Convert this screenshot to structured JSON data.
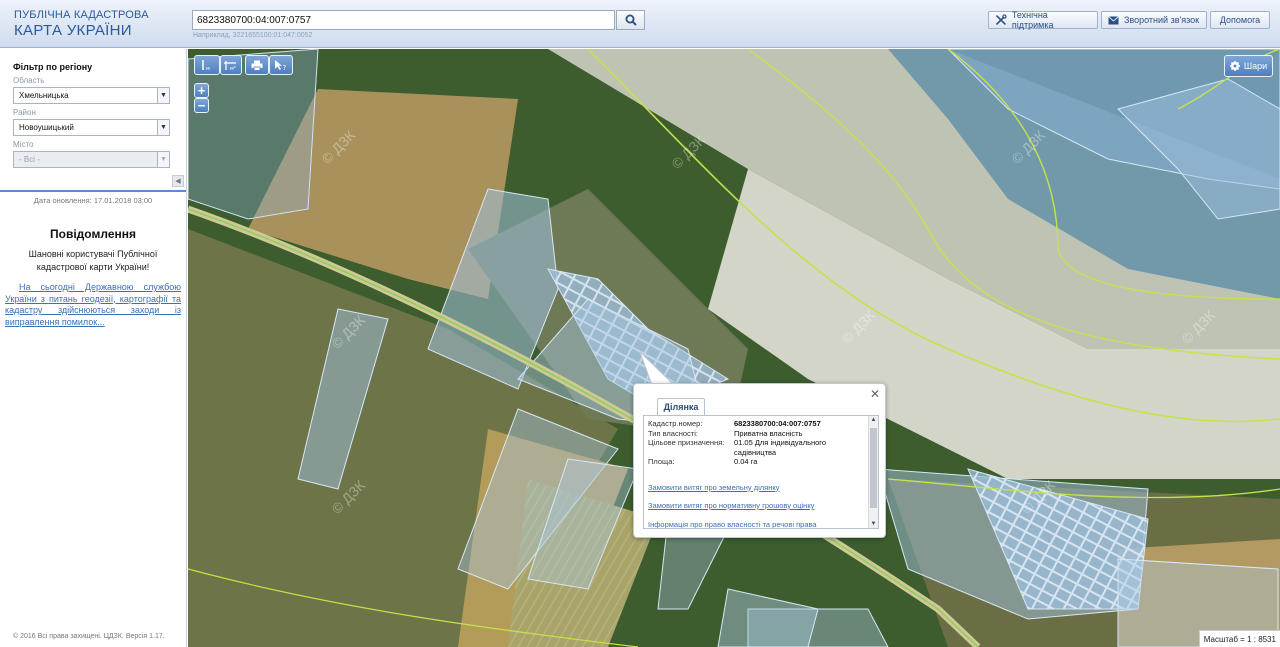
{
  "header": {
    "logo_line1": "ПУБЛІЧНА КАДАСТРОВА",
    "logo_line2": "КАРТА УКРАЇНИ",
    "search_value": "6823380700:04:007:0757",
    "search_hint": "Наприклад, 3221655100:01:047:0052",
    "btn_support": "Технічна підтримка",
    "btn_feedback": "Зворотний зв'язок",
    "btn_help": "Допомога"
  },
  "sidebar": {
    "filter_title": "Фільтр по регіону",
    "oblast_label": "Область",
    "oblast_value": "Хмельницька",
    "rayon_label": "Район",
    "rayon_value": "Новоушицький",
    "misto_label": "Місто",
    "misto_value": "- Всі -",
    "update_date": "Дата оновлення: 17.01.2018 03:00",
    "notice_title": "Повідомлення",
    "notice_text": "Шановні користувачі Публічної кадастрової карти України!",
    "notice_link": "На сьогодні Державною службою України з питань геодезії, картографії та кадастру здійснюються заходи із виправлення помилок...",
    "copyright": "© 2016 Всі права захищені. ЦДЗК. Версія 1.17."
  },
  "map": {
    "layers_label": "Шари",
    "scale_label": "Масштаб = 1 : 8531",
    "watermark": "© ДЗК"
  },
  "popup": {
    "tab_label": "Ділянка",
    "rows": [
      {
        "k": "Кадастр.номер:",
        "v": "6823380700:04:007:0757"
      },
      {
        "k": "Тип власності:",
        "v": "Приватна власність"
      },
      {
        "k": "Цільове призначення:",
        "v": "01.05 Для індивідуального садівництва"
      },
      {
        "k": "Площа:",
        "v": "0.04 га"
      }
    ],
    "link1": "Замовити витяг про земельну ділянку",
    "link2": "Замовити витяг про нормативну грошову оцінку",
    "link3": "Інформація про право власності та речові права"
  }
}
